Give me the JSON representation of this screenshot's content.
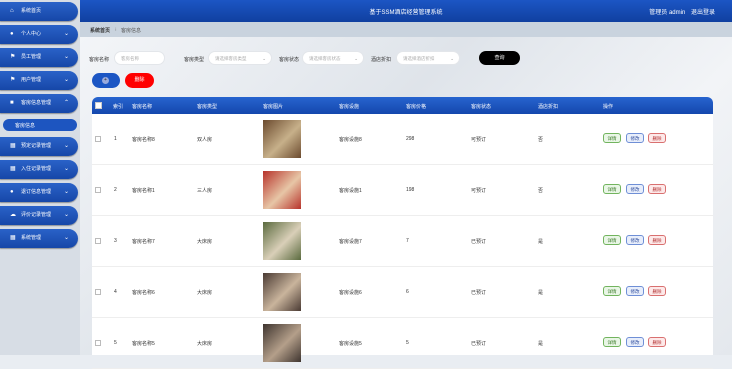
{
  "app": {
    "title": "基于SSM酒店经营管理系统",
    "user_label": "管理员 admin",
    "logout": "退出登录"
  },
  "breadcrumb": {
    "home": "系统首页",
    "current": "客房信息"
  },
  "sidebar": {
    "items": [
      {
        "label": "系统首页",
        "icon": "home-icon"
      },
      {
        "label": "个人中心",
        "icon": "person-icon"
      },
      {
        "label": "员工管理",
        "icon": "flag-icon"
      },
      {
        "label": "用户管理",
        "icon": "flag-icon"
      },
      {
        "label": "客房信息管理",
        "icon": "bed-icon"
      },
      {
        "label": "预定记录管理",
        "icon": "grid-icon"
      },
      {
        "label": "入住记录管理",
        "icon": "grid-icon"
      },
      {
        "label": "退订信息管理",
        "icon": "person-icon"
      },
      {
        "label": "评价记录管理",
        "icon": "cloud-icon"
      },
      {
        "label": "系统管理",
        "icon": "grid-icon"
      }
    ],
    "active_sub": "客房信息"
  },
  "filters": {
    "room_name_label": "客房名称",
    "room_name_placeholder": "客房名称",
    "room_type_label": "客房类型",
    "room_type_placeholder": "请选择客房类型",
    "room_status_label": "客房状态",
    "room_status_placeholder": "请选择客房状态",
    "discount_label": "酒店折扣",
    "discount_placeholder": "请选择酒店折扣",
    "search": "查询"
  },
  "actions": {
    "delete": "删除"
  },
  "table": {
    "headers": [
      "索引",
      "客房名称",
      "客房类型",
      "客房图片",
      "客房设施",
      "客房价格",
      "客房状态",
      "酒店折扣",
      "操作"
    ],
    "row_actions": {
      "detail": "详情",
      "edit": "修改",
      "delete": "删除"
    },
    "rows": [
      {
        "index": "1",
        "name": "客房名称8",
        "type": "双人房",
        "facility": "客房设施8",
        "price": "298",
        "status": "可预订",
        "discount": "否",
        "img": [
          "#6b4a2e",
          "#c7b08a"
        ]
      },
      {
        "index": "2",
        "name": "客房名称1",
        "type": "三人房",
        "facility": "客房设施1",
        "price": "198",
        "status": "可预订",
        "discount": "否",
        "img": [
          "#b7332b",
          "#e7c6a6"
        ]
      },
      {
        "index": "3",
        "name": "客房名称7",
        "type": "大床房",
        "facility": "客房设施7",
        "price": "7",
        "status": "已预订",
        "discount": "是",
        "img": [
          "#5a6a3e",
          "#d9cfb8"
        ]
      },
      {
        "index": "4",
        "name": "客房名称6",
        "type": "大床房",
        "facility": "客房设施6",
        "price": "6",
        "status": "已预订",
        "discount": "是",
        "img": [
          "#4a3a33",
          "#c9b49c"
        ]
      },
      {
        "index": "5",
        "name": "客房名称5",
        "type": "大床房",
        "facility": "客房设施5",
        "price": "5",
        "status": "已预订",
        "discount": "是",
        "img": [
          "#3e342f",
          "#b49f8a"
        ]
      }
    ]
  }
}
